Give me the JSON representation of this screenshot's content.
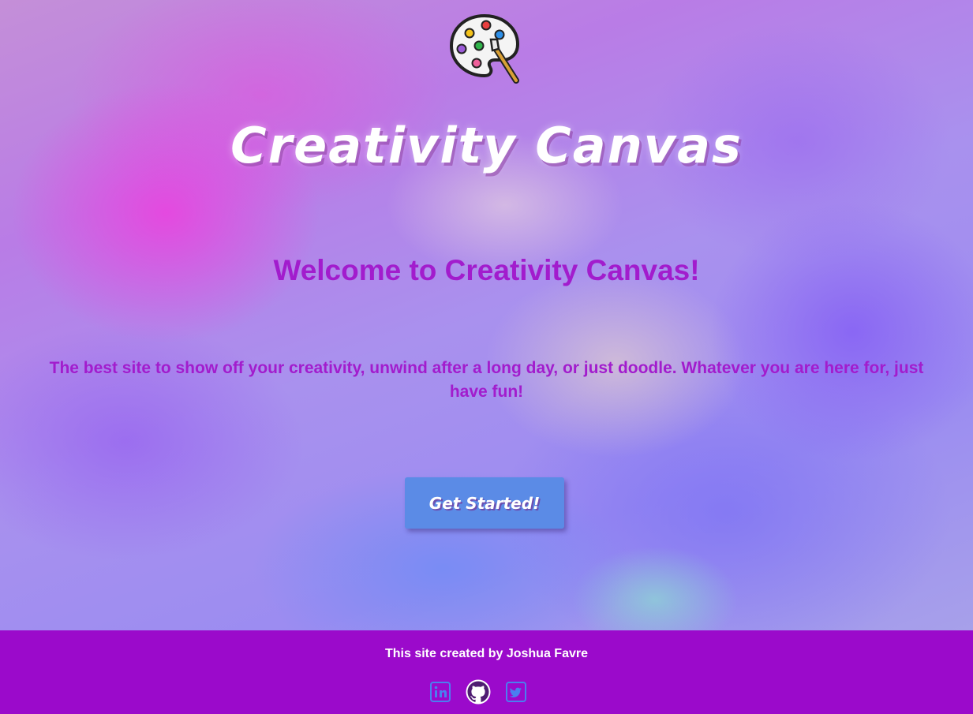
{
  "header": {
    "logo_icon": "paint-palette-icon",
    "site_title": "Creativity Canvas"
  },
  "main": {
    "welcome_heading": "Welcome to Creativity Canvas!",
    "tagline": "The best site to show off your creativity, unwind after a long day, or just doodle. Whatever you are here for, just have fun!",
    "cta_label": "Get Started!"
  },
  "footer": {
    "credit": "This site created by Joshua Favre",
    "social_links": [
      {
        "icon": "linkedin-icon"
      },
      {
        "icon": "github-icon"
      },
      {
        "icon": "twitter-icon"
      }
    ]
  },
  "colors": {
    "heading_purple": "#a21ccd",
    "button_blue": "#5b8be6",
    "footer_purple": "#9b0acb",
    "social_icon_blue": "#4a7ff0"
  }
}
